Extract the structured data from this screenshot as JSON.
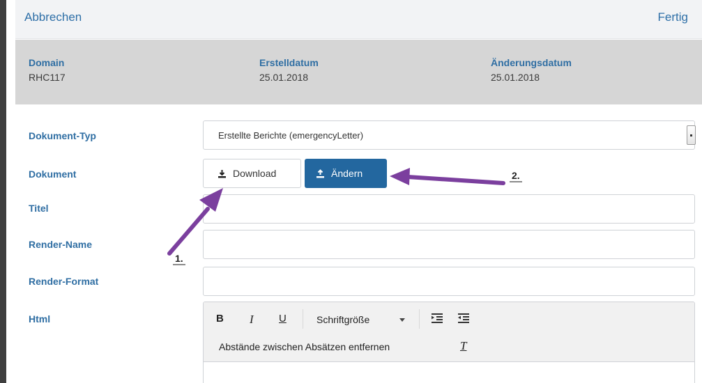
{
  "header": {
    "cancel_label": "Abbrechen",
    "done_label": "Fertig"
  },
  "meta": {
    "domain_label": "Domain",
    "domain_value": "RHC117",
    "created_label": "Erstelldatum",
    "created_value": "25.01.2018",
    "changed_label": "Änderungsdatum",
    "changed_value": "25.01.2018"
  },
  "form": {
    "doc_type_label": "Dokument-Typ",
    "doc_type_value": "Erstellte Berichte (emergencyLetter)",
    "document_label": "Dokument",
    "download_label": "Download",
    "change_label": "Ändern",
    "title_label": "Titel",
    "title_value": "",
    "render_name_label": "Render-Name",
    "render_name_value": "",
    "render_format_label": "Render-Format",
    "render_format_value": "",
    "html_label": "Html"
  },
  "editor": {
    "bold": "B",
    "italic": "I",
    "underline": "U",
    "font_size_label": "Schriftgröße",
    "remove_spacing_label": "Abstände zwischen Absätzen entfernen",
    "clear_format": "T"
  },
  "annotations": {
    "step1": "1.",
    "step2": "2.",
    "arrow_color": "#7b3f9e"
  },
  "colors": {
    "accent": "#23679f",
    "label": "#2f6ea3",
    "meta_bg": "#d6d6d6"
  }
}
